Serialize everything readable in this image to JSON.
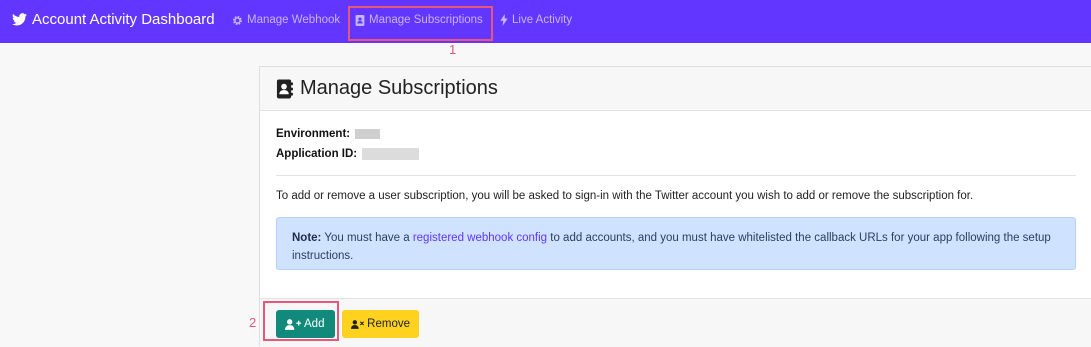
{
  "navbar": {
    "brand": "Account Activity Dashboard",
    "items": [
      {
        "label": "Manage Webhook",
        "icon": "gear-icon"
      },
      {
        "label": "Manage Subscriptions",
        "icon": "address-book-icon"
      },
      {
        "label": "Live Activity",
        "icon": "lightning-icon"
      }
    ]
  },
  "markers": [
    "1",
    "2"
  ],
  "card": {
    "title": "Manage Subscriptions",
    "environment_label": "Environment:",
    "application_id_label": "Application ID:",
    "description": "To add or remove a user subscription, you will be asked to sign-in with the Twitter account you wish to add or remove the subscription for.",
    "note": {
      "bold": "Note:",
      "text_before": " You must have a ",
      "link": "registered webhook config",
      "text_after": " to add accounts, and you must have whitelisted the callback URLs for your app following the setup instructions."
    }
  },
  "buttons": {
    "add": "Add",
    "remove": "Remove"
  },
  "colors": {
    "navbar": "#6236ff",
    "add_button": "#128a7b",
    "remove_button": "#ffd21f",
    "marker": "#e8567a",
    "note_bg": "#cfe2ff"
  }
}
